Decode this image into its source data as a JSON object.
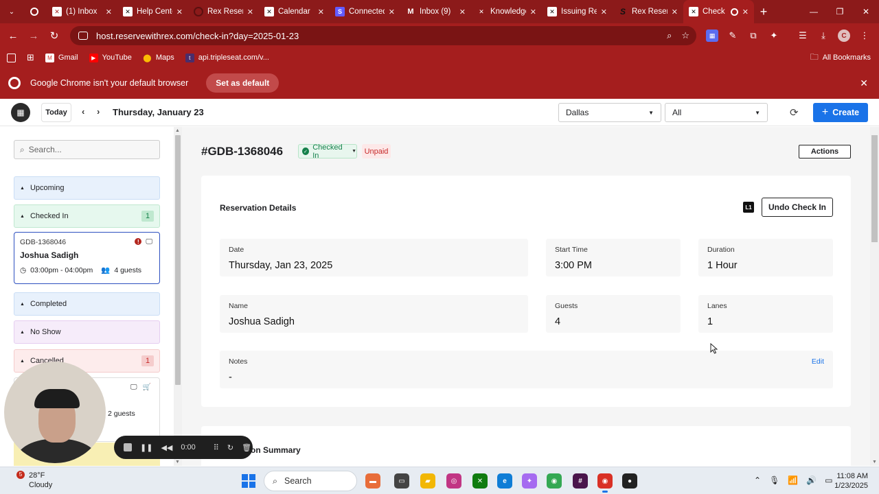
{
  "browser": {
    "tabs": [
      {
        "title": "(1) Inbox",
        "icon": "x-logo-icon"
      },
      {
        "title": "Help Center",
        "icon": "x-logo-icon"
      },
      {
        "title": "Rex Reservations",
        "icon": "circle-icon"
      },
      {
        "title": "Calendar",
        "icon": "x-logo-icon"
      },
      {
        "title": "Connected",
        "icon": "s-logo-icon"
      },
      {
        "title": "Inbox (9)",
        "icon": "gmail-icon"
      },
      {
        "title": "Knowledge",
        "icon": "x-logo-icon"
      },
      {
        "title": "Issuing Re",
        "icon": "x-logo-icon"
      },
      {
        "title": "Rex Reser",
        "icon": "s-italic-icon"
      },
      {
        "title": "Check",
        "icon": "x-logo-icon",
        "active": true
      }
    ],
    "url": "host.reservewithrex.com/check-in?day=2025-01-23",
    "profile_initial": "C",
    "bookmarks": [
      {
        "label": "Gmail",
        "icon": "gmail-icon"
      },
      {
        "label": "YouTube",
        "icon": "youtube-icon"
      },
      {
        "label": "Maps",
        "icon": "maps-icon"
      },
      {
        "label": "api.tripleseat.com/v...",
        "icon": "tripleseat-icon"
      }
    ],
    "all_bookmarks": "All Bookmarks",
    "infobar": {
      "message": "Google Chrome isn't your default browser",
      "button": "Set as default"
    }
  },
  "header": {
    "today": "Today",
    "date": "Thursday, January 23",
    "location": "Dallas",
    "filter": "All",
    "create": "Create"
  },
  "sidebar": {
    "search_placeholder": "Search...",
    "sections": {
      "upcoming": {
        "label": "Upcoming"
      },
      "checked_in": {
        "label": "Checked In",
        "count": "1"
      },
      "completed": {
        "label": "Completed"
      },
      "no_show": {
        "label": "No Show"
      },
      "cancelled": {
        "label": "Cancelled",
        "count": "1"
      }
    },
    "checked_in_card": {
      "id": "GDB-1368046",
      "name": "Joshua Sadigh",
      "time": "03:00pm - 04:00pm",
      "guests": "4 guests"
    },
    "cancelled_card": {
      "guests": "2 guests"
    }
  },
  "reservation": {
    "id": "#GDB-1368046",
    "status": "Checked In",
    "payment": "Unpaid",
    "actions": "Actions",
    "details_title": "Reservation Details",
    "lane_tag": "L1",
    "undo": "Undo Check In",
    "fields": {
      "date": {
        "label": "Date",
        "value": "Thursday, Jan 23, 2025"
      },
      "start_time": {
        "label": "Start Time",
        "value": "3:00 PM"
      },
      "duration": {
        "label": "Duration",
        "value": "1 Hour"
      },
      "name": {
        "label": "Name",
        "value": "Joshua Sadigh"
      },
      "guests": {
        "label": "Guests",
        "value": "4"
      },
      "lanes": {
        "label": "Lanes",
        "value": "1"
      },
      "notes": {
        "label": "Notes",
        "value": "-",
        "edit": "Edit"
      }
    },
    "summary_title": "on Summary"
  },
  "recorder": {
    "time": "0:00"
  },
  "taskbar": {
    "weather_temp": "28°F",
    "weather_desc": "Cloudy",
    "weather_badge": "5",
    "search": "Search",
    "time": "11:08 AM",
    "date": "1/23/2025"
  },
  "colors": {
    "chrome_red": "#a51e1e",
    "accent_blue": "#1a73e8",
    "checked_in_green": "#14804a",
    "unpaid_red": "#c62828"
  }
}
